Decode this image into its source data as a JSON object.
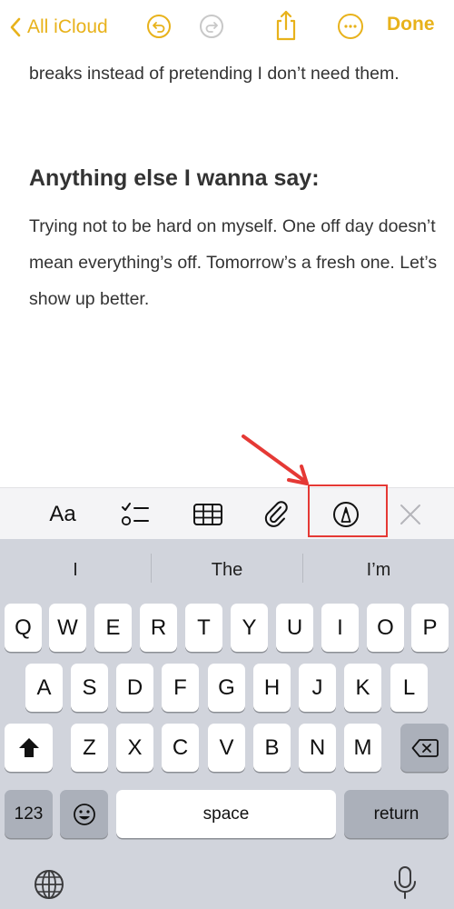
{
  "nav": {
    "back_label": "All iCloud",
    "done_label": "Done",
    "accent": "#e8b21b",
    "icons": [
      "chevron-left-icon",
      "undo-icon",
      "redo-icon",
      "share-icon",
      "more-icon"
    ]
  },
  "note": {
    "paragraph1": "breaks instead of pretending I don’t need them.",
    "heading": "Anything else I wanna say:",
    "paragraph2": "Trying not to be hard on myself. One off day doesn’t mean everything’s off. Tomorrow’s a fresh one. Let’s show up better."
  },
  "toolbar": {
    "format_label": "Aa",
    "icons": [
      "format-icon",
      "checklist-icon",
      "table-icon",
      "attachment-icon",
      "markup-icon",
      "close-icon"
    ]
  },
  "annotation": {
    "highlight_color": "#e53935"
  },
  "keyboard": {
    "suggestions": [
      "I",
      "The",
      "I’m"
    ],
    "row1": [
      "Q",
      "W",
      "E",
      "R",
      "T",
      "Y",
      "U",
      "I",
      "O",
      "P"
    ],
    "row2": [
      "A",
      "S",
      "D",
      "F",
      "G",
      "H",
      "J",
      "K",
      "L"
    ],
    "row3": [
      "Z",
      "X",
      "C",
      "V",
      "B",
      "N",
      "M"
    ],
    "numbers_label": "123",
    "space_label": "space",
    "return_label": "return"
  }
}
